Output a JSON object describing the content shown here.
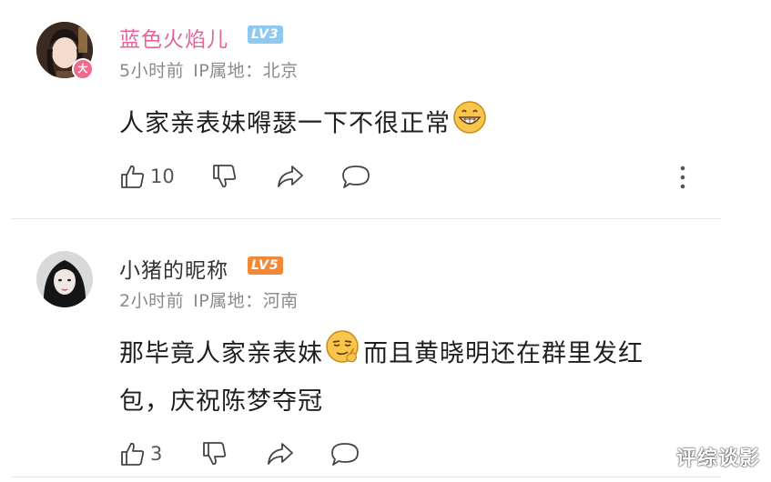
{
  "comments": [
    {
      "username": "蓝色火焰儿",
      "username_color": "#e5649b",
      "level": "LV3",
      "level_color": "#8ec9f0",
      "badge": "大",
      "time": "5小时前",
      "ip_location": "IP属地：北京",
      "text_before_emoji": "人家亲表妹嘚瑟一下不很正常",
      "text_after_emoji": "",
      "emoji": "grinning-emoji",
      "likes": "10"
    },
    {
      "username": "小猪的昵称",
      "username_color": "#333333",
      "level": "LV5",
      "level_color": "#f08a3a",
      "time": "2小时前",
      "ip_location": "IP属地：河南",
      "text_before_emoji": "那毕竟人家亲表妹",
      "text_after_emoji": "而且黄晓明还在群里发红",
      "text_line2": "包，庆祝陈梦夺冠",
      "emoji": "smirk-thinking-emoji",
      "likes": "3"
    }
  ],
  "watermark": "评综谈影"
}
